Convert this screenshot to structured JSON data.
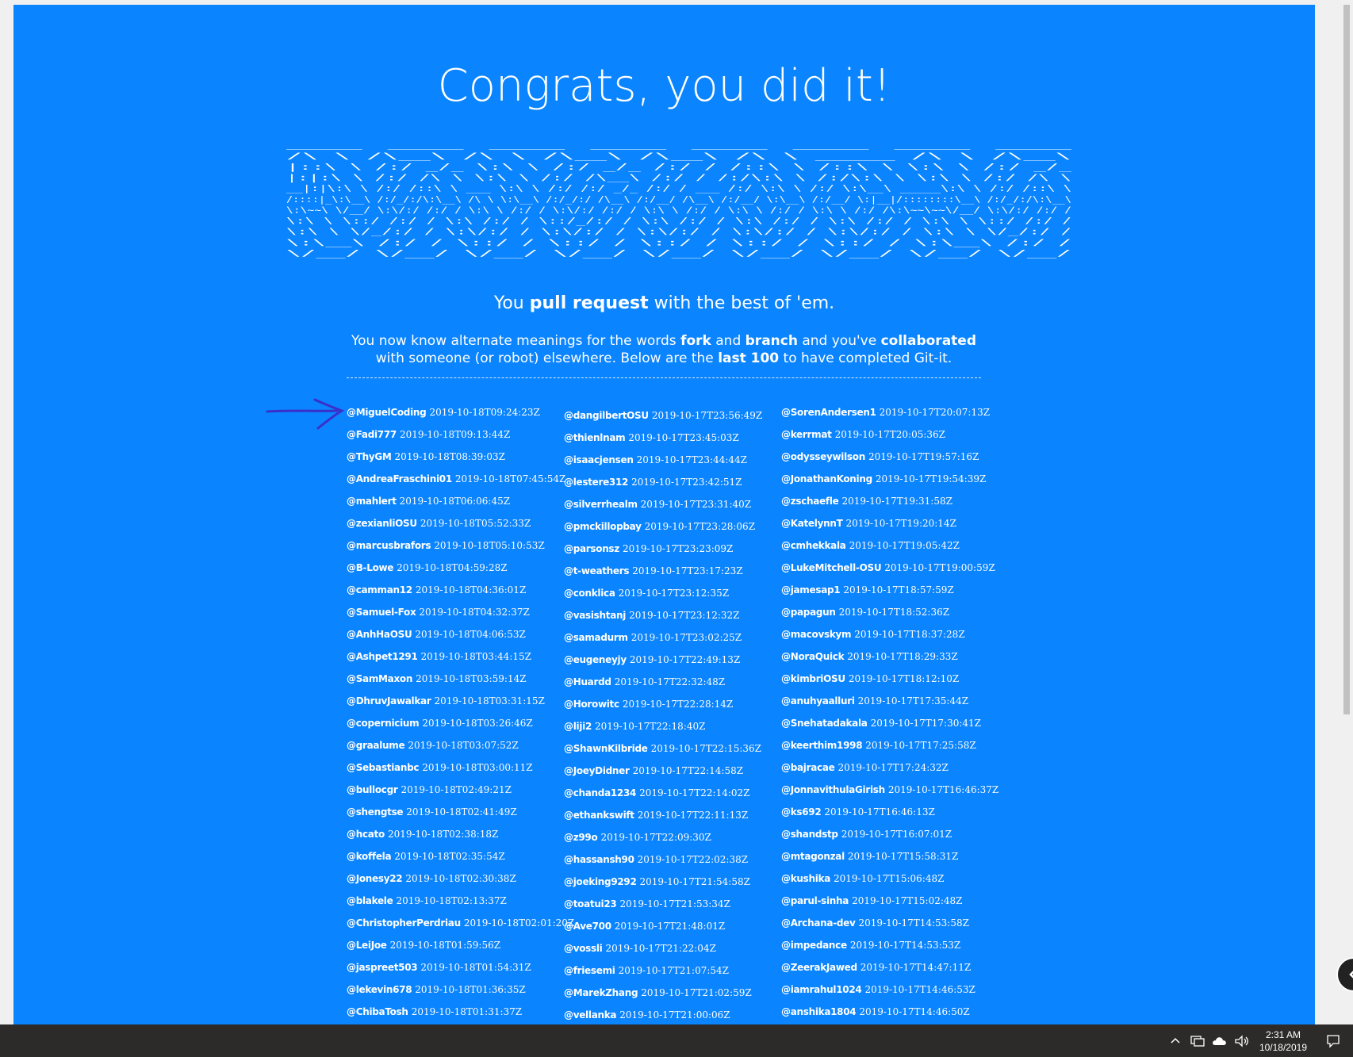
{
  "title": "Congrats, you did it!",
  "tagline": {
    "pre": "You ",
    "bold": "pull request",
    "post": " with the best of 'em."
  },
  "description": {
    "t1": "You now know alternate meanings for the words ",
    "b1": "fork",
    "t2": " and ",
    "b2": "branch",
    "t3": " and you've ",
    "b3": "collaborated",
    "t4": " with someone (or robot) elsewhere. Below are the ",
    "b4": "last 100",
    "t5": " to have completed Git-it."
  },
  "ascii_art": [
    "     ___           ___           ___           ___           ___           ___                         ___           ___     ",
    "    /\\  \\         /\\__\\         /\\  \\         /\\__\\         /\\__\\         /\\  \\         _____        /\\  \\         /\\__\\    ",
    "   |::\\  \\       /:/ _/_        \\:\\  \\       /:/ _/_       /:/  /        /::\\  \\       /::\\  \\       \\:\\  \\       /:/ _/_   ",
    "   |:|:\\  \\     /:/ /\\  \\        \\:\\  \\     /:/ /\\__\\     /:/  /        /:/\\:\\  \\     /:/\\:\\  \\       \\:\\  \\     /:/ /\\  \\  ",
    " __|:|\\:\\  \\   /:/ /::\\  \\   ___  \\:\\  \\   /:/ /:/ _/_   /:/  /  ___   /:/  \\:\\  \\   /:/  \\:\\__\\  _____\\:\\  \\   /:/ /::\\  \\ ",
    "/::::|_\\:\\__\\ /:/_/:/\\:\\__\\ /\\  \\  \\:\\__\\ /:/_/:/ /\\__\\ /:/__/  /\\__\\ /:/__/ \\:\\__\\ /:/__/ \\:|__|/::::::::\\__\\ /:/_/:/\\:\\__\\",
    "\\:\\~~\\  \\/__/ \\:\\/:/ /:/  / \\:\\  \\ /:/  / \\:\\/:/ /:/  / \\:\\  \\ /:/  / \\:\\  \\ /:/  / \\:\\  \\ /:/  /\\:\\~~\\~~\\/__/ \\:\\/:/ /:/  /",
    " \\:\\  \\        \\::/ /:/  /   \\:\\  /:/  /   \\::/_/:/  /   \\:\\  /:/  /   \\:\\  /:/  /   \\:\\  /:/  /  \\:\\  \\        \\::/ /:/  / ",
    "  \\:\\  \\        \\/_/:/  /     \\:\\/:/  /     \\:\\/:/  /     \\:\\/:/  /     \\:\\/:/  /     \\:\\/:/  /    \\:\\  \\        \\/_/:/  /  ",
    "   \\:\\__\\         /:/  /       \\::/  /       \\::/  /       \\::/  /       \\::/  /       \\::/  /      \\:\\__\\         /:/  /   ",
    "    \\/__/         \\/__/         \\/__/         \\/__/         \\/__/         \\/__/         \\/__/        \\/__/         \\/__/    "
  ],
  "completers": {
    "col1": [
      {
        "user": "@MiguelCoding",
        "time": "2019-10-18T09:24:23Z"
      },
      {
        "user": "@Fadi777",
        "time": "2019-10-18T09:13:44Z"
      },
      {
        "user": "@ThyGM",
        "time": "2019-10-18T08:39:03Z"
      },
      {
        "user": "@AndreaFraschini01",
        "time": "2019-10-18T07:45:54Z"
      },
      {
        "user": "@mahlert",
        "time": "2019-10-18T06:06:45Z"
      },
      {
        "user": "@zexianliOSU",
        "time": "2019-10-18T05:52:33Z"
      },
      {
        "user": "@marcusbrafors",
        "time": "2019-10-18T05:10:53Z"
      },
      {
        "user": "@B-Lowe",
        "time": "2019-10-18T04:59:28Z"
      },
      {
        "user": "@camman12",
        "time": "2019-10-18T04:36:01Z"
      },
      {
        "user": "@Samuel-Fox",
        "time": "2019-10-18T04:32:37Z"
      },
      {
        "user": "@AnhHaOSU",
        "time": "2019-10-18T04:06:53Z"
      },
      {
        "user": "@Ashpet1291",
        "time": "2019-10-18T03:44:15Z"
      },
      {
        "user": "@SamMaxon",
        "time": "2019-10-18T03:59:14Z"
      },
      {
        "user": "@DhruvJawalkar",
        "time": "2019-10-18T03:31:15Z"
      },
      {
        "user": "@copernicium",
        "time": "2019-10-18T03:26:46Z"
      },
      {
        "user": "@graalume",
        "time": "2019-10-18T03:07:52Z"
      },
      {
        "user": "@Sebastianbc",
        "time": "2019-10-18T03:00:11Z"
      },
      {
        "user": "@bullocgr",
        "time": "2019-10-18T02:49:21Z"
      },
      {
        "user": "@shengtse",
        "time": "2019-10-18T02:41:49Z"
      },
      {
        "user": "@hcato",
        "time": "2019-10-18T02:38:18Z"
      },
      {
        "user": "@koffela",
        "time": "2019-10-18T02:35:54Z"
      },
      {
        "user": "@Jonesy22",
        "time": "2019-10-18T02:30:38Z"
      },
      {
        "user": "@blakele",
        "time": "2019-10-18T02:13:37Z"
      },
      {
        "user": "@ChristopherPerdriau",
        "time": "2019-10-18T02:01:20Z"
      },
      {
        "user": "@LeiJoe",
        "time": "2019-10-18T01:59:56Z"
      },
      {
        "user": "@jaspreet503",
        "time": "2019-10-18T01:54:31Z"
      },
      {
        "user": "@lekevin678",
        "time": "2019-10-18T01:36:35Z"
      },
      {
        "user": "@ChibaTosh",
        "time": "2019-10-18T01:31:37Z"
      }
    ],
    "col2": [
      {
        "user": "@dangilbertOSU",
        "time": "2019-10-17T23:56:49Z"
      },
      {
        "user": "@thienlnam",
        "time": "2019-10-17T23:45:03Z"
      },
      {
        "user": "@isaacjensen",
        "time": "2019-10-17T23:44:44Z"
      },
      {
        "user": "@lestere312",
        "time": "2019-10-17T23:42:51Z"
      },
      {
        "user": "@silverrhealm",
        "time": "2019-10-17T23:31:40Z"
      },
      {
        "user": "@pmckillopbay",
        "time": "2019-10-17T23:28:06Z"
      },
      {
        "user": "@parsonsz",
        "time": "2019-10-17T23:23:09Z"
      },
      {
        "user": "@t-weathers",
        "time": "2019-10-17T23:17:23Z"
      },
      {
        "user": "@conklica",
        "time": "2019-10-17T23:12:35Z"
      },
      {
        "user": "@vasishtanj",
        "time": "2019-10-17T23:12:32Z"
      },
      {
        "user": "@samadurm",
        "time": "2019-10-17T23:02:25Z"
      },
      {
        "user": "@eugeneyjy",
        "time": "2019-10-17T22:49:13Z"
      },
      {
        "user": "@Huardd",
        "time": "2019-10-17T22:32:48Z"
      },
      {
        "user": "@Horowitc",
        "time": "2019-10-17T22:28:14Z"
      },
      {
        "user": "@liji2",
        "time": "2019-10-17T22:18:40Z"
      },
      {
        "user": "@ShawnKilbride",
        "time": "2019-10-17T22:15:36Z"
      },
      {
        "user": "@JoeyDidner",
        "time": "2019-10-17T22:14:58Z"
      },
      {
        "user": "@chanda1234",
        "time": "2019-10-17T22:14:02Z"
      },
      {
        "user": "@ethankswift",
        "time": "2019-10-17T22:11:13Z"
      },
      {
        "user": "@z99o",
        "time": "2019-10-17T22:09:30Z"
      },
      {
        "user": "@hassansh90",
        "time": "2019-10-17T22:02:38Z"
      },
      {
        "user": "@joeking9292",
        "time": "2019-10-17T21:54:58Z"
      },
      {
        "user": "@toatui23",
        "time": "2019-10-17T21:53:34Z"
      },
      {
        "user": "@Ave700",
        "time": "2019-10-17T21:48:01Z"
      },
      {
        "user": "@vossli",
        "time": "2019-10-17T21:22:04Z"
      },
      {
        "user": "@friesemi",
        "time": "2019-10-17T21:07:54Z"
      },
      {
        "user": "@MarekZhang",
        "time": "2019-10-17T21:02:59Z"
      },
      {
        "user": "@vellanka",
        "time": "2019-10-17T21:00:06Z"
      }
    ],
    "col3": [
      {
        "user": "@SorenAndersen1",
        "time": "2019-10-17T20:07:13Z"
      },
      {
        "user": "@kerrmat",
        "time": "2019-10-17T20:05:36Z"
      },
      {
        "user": "@odysseywilson",
        "time": "2019-10-17T19:57:16Z"
      },
      {
        "user": "@JonathanKoning",
        "time": "2019-10-17T19:54:39Z"
      },
      {
        "user": "@zschaefle",
        "time": "2019-10-17T19:31:58Z"
      },
      {
        "user": "@KatelynnT",
        "time": "2019-10-17T19:20:14Z"
      },
      {
        "user": "@cmhekkala",
        "time": "2019-10-17T19:05:42Z"
      },
      {
        "user": "@LukeMitchell-OSU",
        "time": "2019-10-17T19:00:59Z"
      },
      {
        "user": "@jamesap1",
        "time": "2019-10-17T18:57:59Z"
      },
      {
        "user": "@papagun",
        "time": "2019-10-17T18:52:36Z"
      },
      {
        "user": "@macovskym",
        "time": "2019-10-17T18:37:28Z"
      },
      {
        "user": "@NoraQuick",
        "time": "2019-10-17T18:29:33Z"
      },
      {
        "user": "@kimbriOSU",
        "time": "2019-10-17T18:12:10Z"
      },
      {
        "user": "@anuhyaalluri",
        "time": "2019-10-17T17:35:44Z"
      },
      {
        "user": "@Snehatadakala",
        "time": "2019-10-17T17:30:41Z"
      },
      {
        "user": "@keerthim1998",
        "time": "2019-10-17T17:25:58Z"
      },
      {
        "user": "@bajracae",
        "time": "2019-10-17T17:24:32Z"
      },
      {
        "user": "@JonnavithulaGirish",
        "time": "2019-10-17T16:46:37Z"
      },
      {
        "user": "@ks692",
        "time": "2019-10-17T16:46:13Z"
      },
      {
        "user": "@shandstp",
        "time": "2019-10-17T16:07:01Z"
      },
      {
        "user": "@mtagonzal",
        "time": "2019-10-17T15:58:31Z"
      },
      {
        "user": "@kushika",
        "time": "2019-10-17T15:06:48Z"
      },
      {
        "user": "@parul-sinha",
        "time": "2019-10-17T15:02:48Z"
      },
      {
        "user": "@Archana-dev",
        "time": "2019-10-17T14:53:58Z"
      },
      {
        "user": "@impedance",
        "time": "2019-10-17T14:53:53Z"
      },
      {
        "user": "@ZeerakJawed",
        "time": "2019-10-17T14:47:11Z"
      },
      {
        "user": "@iamrahul1024",
        "time": "2019-10-17T14:46:53Z"
      },
      {
        "user": "@anshika1804",
        "time": "2019-10-17T14:46:50Z"
      }
    ]
  },
  "taskbar": {
    "time": "2:31 AM",
    "date": "10/18/2019",
    "tray_icons": [
      "chevron-up-icon",
      "network-icon",
      "onedrive-cloud-icon",
      "volume-icon"
    ],
    "notification_icon": "notification-icon"
  },
  "colors": {
    "page_background": "#0a84ff",
    "arrow": "#3b2fc9",
    "taskbar": "#2d2a2a"
  }
}
